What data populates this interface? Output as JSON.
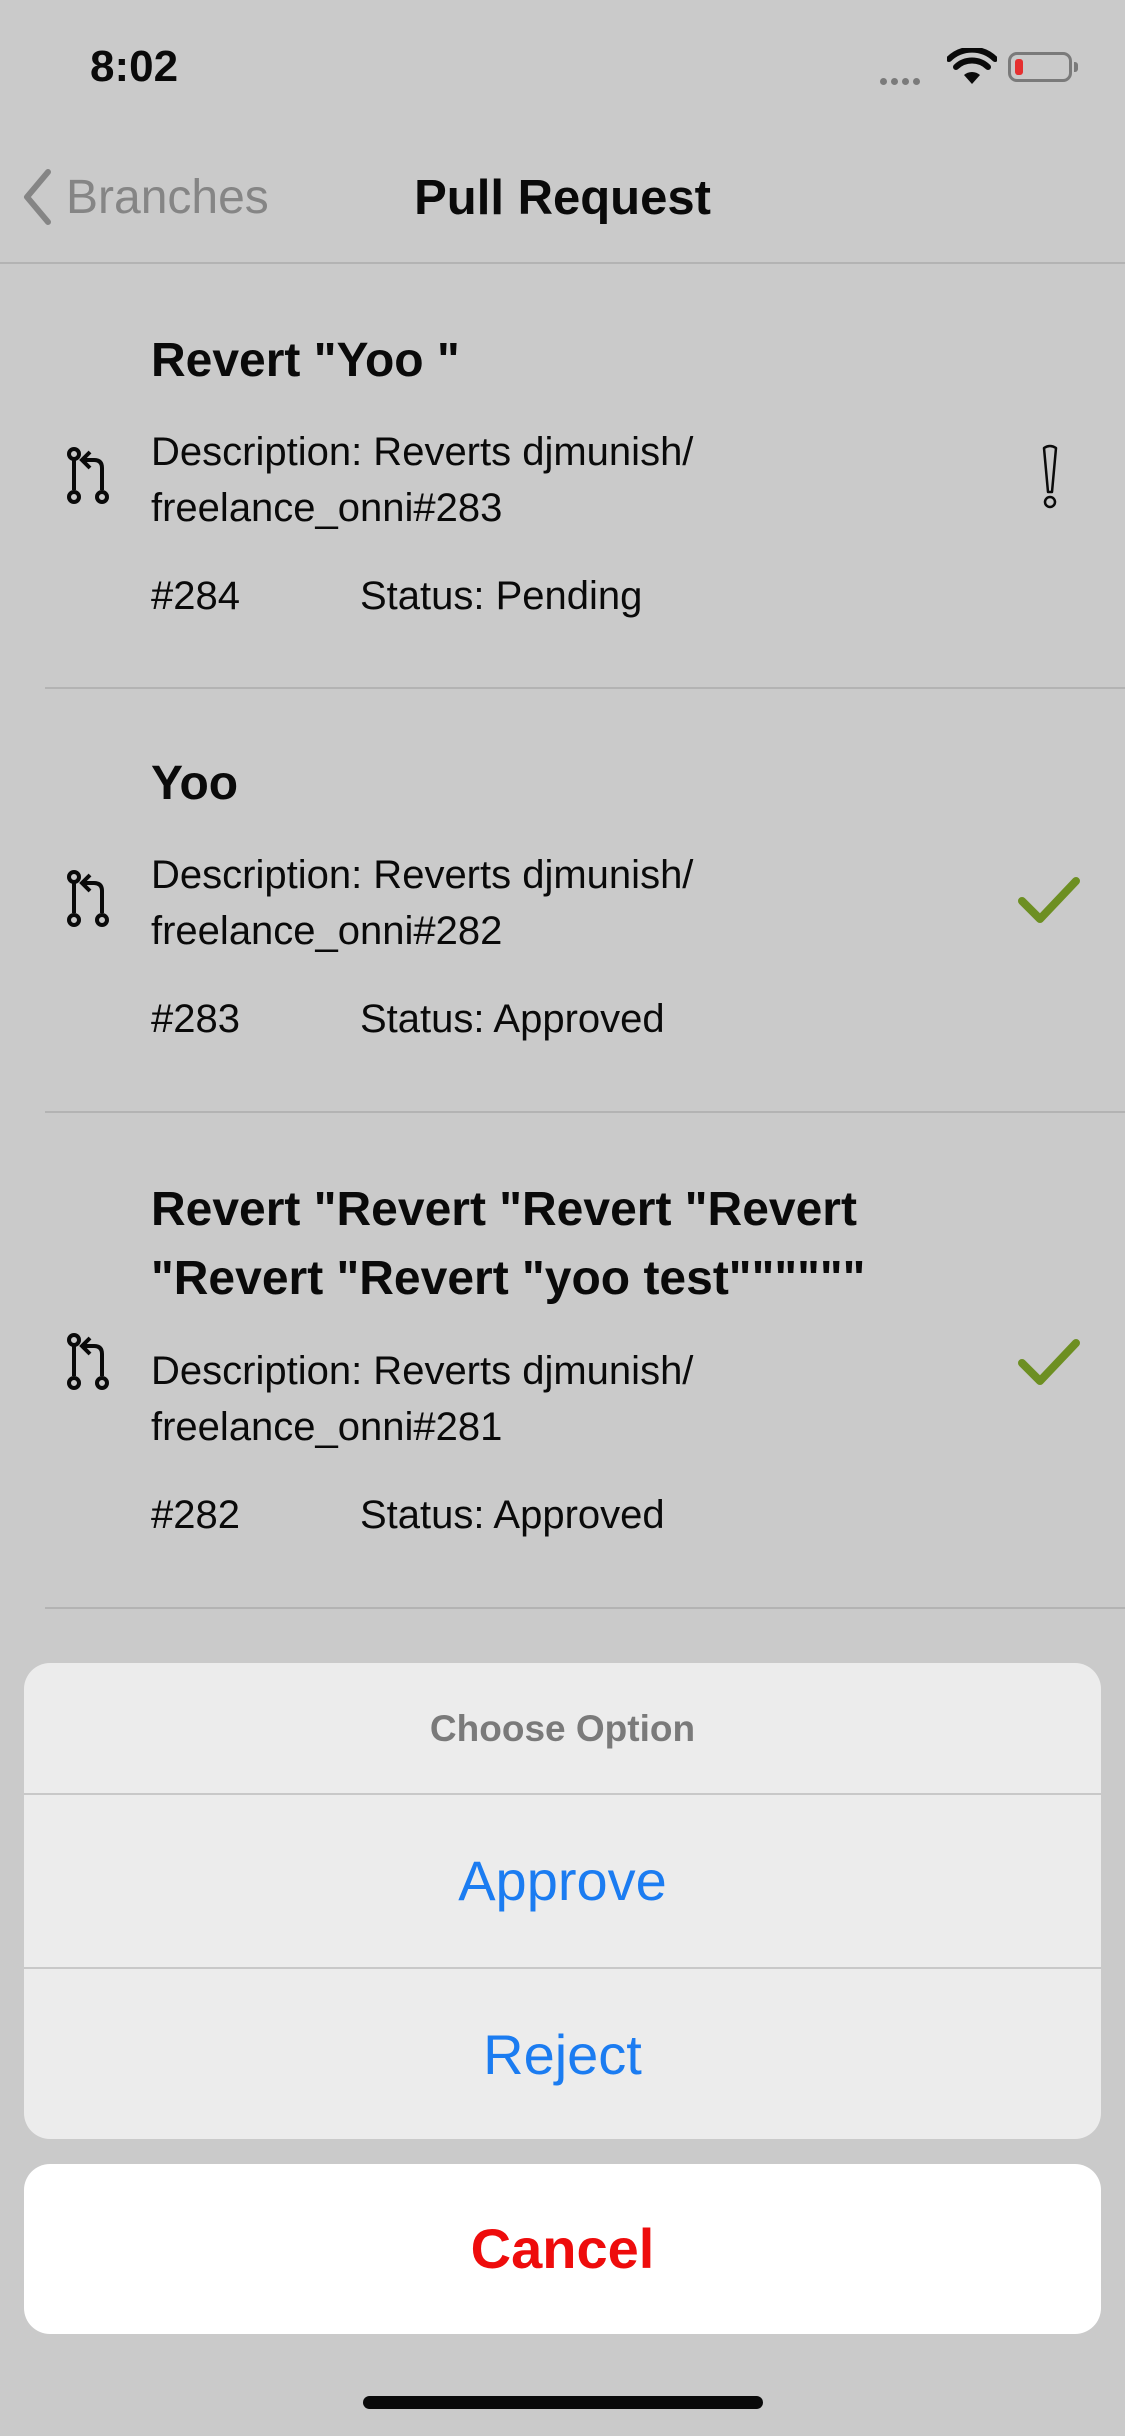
{
  "status_bar": {
    "time": "8:02"
  },
  "nav": {
    "back_label": "Branches",
    "title": "Pull Request"
  },
  "pull_requests": [
    {
      "title": "Revert \"Yoo \"",
      "description": "Description: Reverts djmunish/ freelance_onni#283",
      "number": "#284",
      "status": "Status: Pending",
      "status_icon": "exclamation-icon"
    },
    {
      "title": "Yoo",
      "description": "Description: Reverts djmunish/ freelance_onni#282",
      "number": "#283",
      "status": "Status: Approved",
      "status_icon": "checkmark-icon"
    },
    {
      "title": "Revert \"Revert \"Revert \"Revert \"Revert \"Revert \"yoo test\"\"\"\"\"\"",
      "description": "Description: Reverts djmunish/ freelance_onni#281",
      "number": "#282",
      "status": "Status: Approved",
      "status_icon": "checkmark-icon"
    }
  ],
  "action_sheet": {
    "title": "Choose Option",
    "approve_label": "Approve",
    "reject_label": "Reject",
    "cancel_label": "Cancel"
  },
  "colors": {
    "accent_blue": "#1b7cf1",
    "destructive_red": "#ee0c0c",
    "approved_green": "#6d8f22"
  }
}
